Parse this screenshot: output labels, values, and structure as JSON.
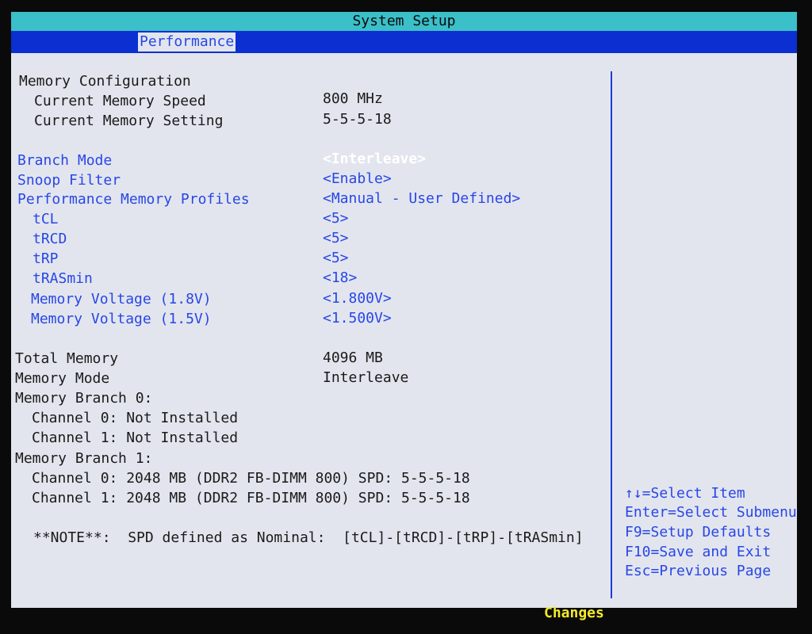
{
  "window": {
    "title": "System Setup"
  },
  "tabs": [
    {
      "label": "Performance",
      "active": true
    }
  ],
  "memory": {
    "section_title": "Memory Configuration",
    "speed_label": "Current Memory Speed",
    "speed_value": "800 MHz",
    "setting_label": "Current Memory Setting",
    "setting_value": "5-5-5-18",
    "options": [
      {
        "label": "Branch Mode",
        "value": "<Interleave>",
        "selected": true
      },
      {
        "label": "Snoop Filter",
        "value": "<Enable>"
      },
      {
        "label": "Performance Memory Profiles",
        "value": "<Manual - User Defined>"
      },
      {
        "label": "tCL",
        "value": "<5>"
      },
      {
        "label": "tRCD",
        "value": "<5>"
      },
      {
        "label": "tRP",
        "value": "<5>"
      },
      {
        "label": "tRASmin",
        "value": "<18>"
      },
      {
        "label": "Memory Voltage (1.8V)",
        "value": "<1.800V>"
      },
      {
        "label": "Memory Voltage (1.5V)",
        "value": "<1.500V>"
      }
    ],
    "total_label": "Total Memory",
    "total_value": "4096 MB",
    "mode_label": "Memory Mode",
    "mode_value": "Interleave",
    "branch0_label": "Memory Branch 0:",
    "branch0_ch0": "Channel 0: Not Installed",
    "branch0_ch1": "Channel 1: Not Installed",
    "branch1_label": "Memory Branch 1:",
    "branch1_ch0": "Channel 0: 2048 MB (DDR2 FB-DIMM 800) SPD: 5-5-5-18",
    "branch1_ch1": "Channel 1: 2048 MB (DDR2 FB-DIMM 800) SPD: 5-5-5-18",
    "note": "**NOTE**:  SPD defined as Nominal:  [tCL]-[tRCD]-[tRP]-[tRASmin]"
  },
  "help": [
    "↑↓=Select Item",
    "Enter=Select Submenu",
    "F9=Setup Defaults",
    "F10=Save and Exit",
    "Esc=Previous Page"
  ],
  "status": {
    "changes": "Changes"
  },
  "colors": {
    "title_bar": "#3bbfc9",
    "tab_bar": "#0b2fd1",
    "panel_bg": "#e3e5ee",
    "option_text": "#2747e6",
    "selected_text": "#ffffff",
    "status_text": "#f3e92a"
  }
}
